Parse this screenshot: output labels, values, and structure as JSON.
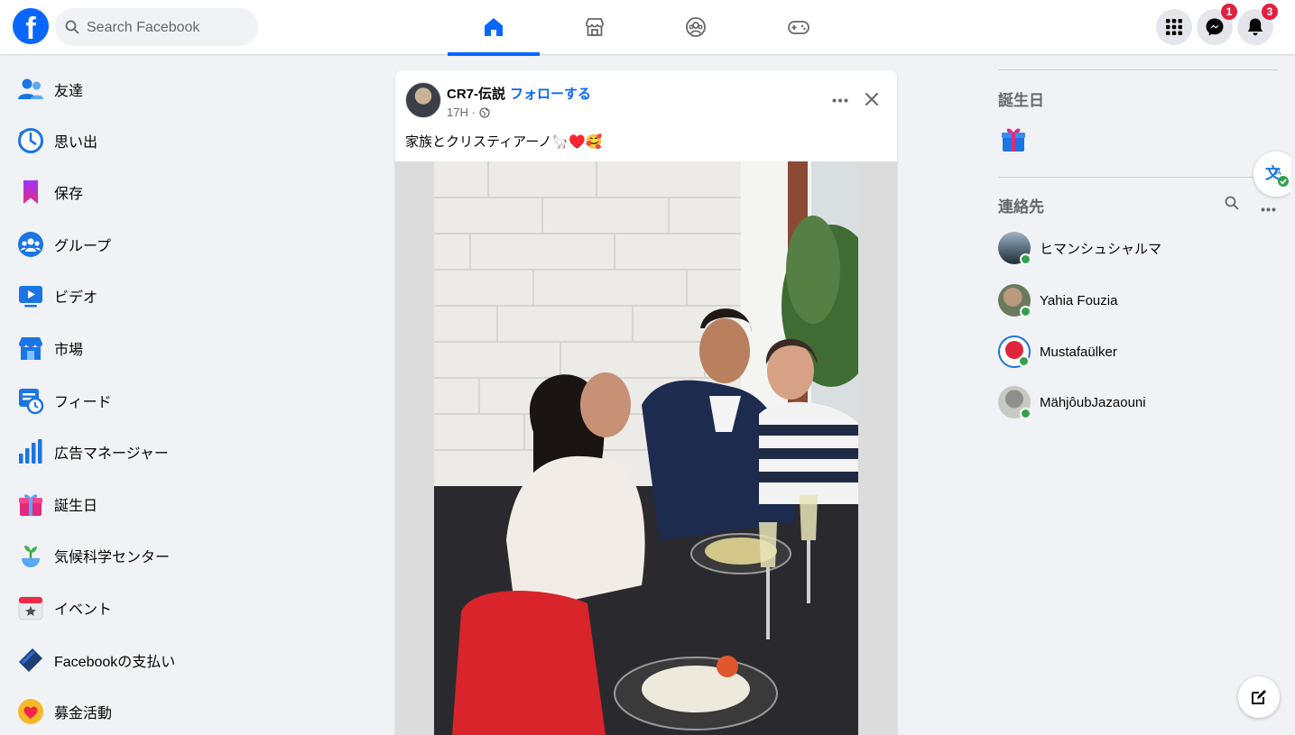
{
  "colors": {
    "brand": "#0866ff",
    "badge": "#e41e3f",
    "online": "#31a24c"
  },
  "header": {
    "logo_icon": "facebook-logo",
    "logo_letter": "f",
    "search_placeholder": "Search Facebook",
    "nav_tabs": [
      {
        "name": "home",
        "icon": "home-icon",
        "active": true
      },
      {
        "name": "marketplace",
        "icon": "store-icon",
        "active": false
      },
      {
        "name": "groups",
        "icon": "groups-icon",
        "active": false
      },
      {
        "name": "gaming",
        "icon": "gamepad-icon",
        "active": false
      }
    ],
    "messenger_badge": "1",
    "notifications_badge": "3"
  },
  "sidebar": {
    "items": [
      {
        "label": "友達",
        "icon": "friends-icon"
      },
      {
        "label": "思い出",
        "icon": "memories-icon"
      },
      {
        "label": "保存",
        "icon": "saved-icon"
      },
      {
        "label": "グループ",
        "icon": "groups-icon"
      },
      {
        "label": "ビデオ",
        "icon": "video-icon"
      },
      {
        "label": "市場",
        "icon": "marketplace-icon"
      },
      {
        "label": "フィード",
        "icon": "feeds-icon"
      },
      {
        "label": "広告マネージャー",
        "icon": "ads-manager-icon"
      },
      {
        "label": "誕生日",
        "icon": "birthday-icon"
      },
      {
        "label": "気候科学センター",
        "icon": "climate-icon"
      },
      {
        "label": "イベント",
        "icon": "events-icon"
      },
      {
        "label": "Facebookの支払い",
        "icon": "payments-icon"
      },
      {
        "label": "募金活動",
        "icon": "fundraiser-icon"
      }
    ]
  },
  "post": {
    "author": "CR7-伝説",
    "separator": "·",
    "follow_label": "フォローする",
    "time": "17H ·",
    "caption": "家族とクリスティアーノ🦙♥️🥰"
  },
  "right": {
    "birthdays_title": "誕生日",
    "contacts_title": "連絡先",
    "contacts": [
      {
        "name": "ヒマンシュシャルマ"
      },
      {
        "name": "Yahia Fouzia"
      },
      {
        "name": "Mustafaülker"
      },
      {
        "name": "MähjôubJazaouni"
      }
    ]
  }
}
